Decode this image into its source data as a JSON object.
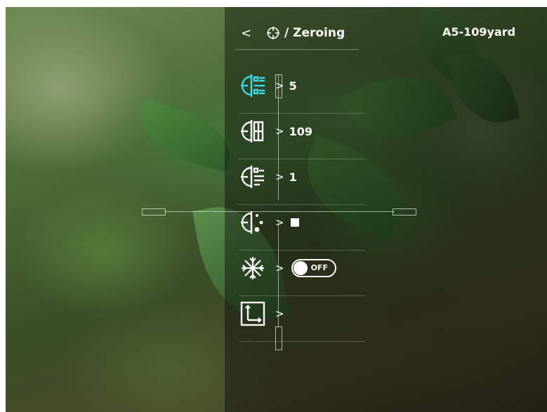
{
  "header": {
    "back_glyph": "<",
    "title": "/ Zeroing",
    "profile": "A5-109yard"
  },
  "menu": {
    "arrow": ">",
    "items": [
      {
        "name": "zero-profile",
        "icon": "reticle-list-icon",
        "value": "5",
        "selected": true
      },
      {
        "name": "zeroing-distance",
        "icon": "reticle-distance-icon",
        "value": "109"
      },
      {
        "name": "reticle-style",
        "icon": "reticle-style-icon",
        "value": "1"
      },
      {
        "name": "reticle-color",
        "icon": "reticle-color-icon",
        "value_type": "swatch",
        "swatch_color": "#ffffff"
      },
      {
        "name": "freeze",
        "icon": "snowflake-icon",
        "value_type": "toggle",
        "toggle_text": "OFF"
      },
      {
        "name": "reticle-position",
        "icon": "axes-icon",
        "value": ""
      }
    ]
  },
  "colors": {
    "accent": "#33e0ec",
    "text": "#ffffff"
  }
}
